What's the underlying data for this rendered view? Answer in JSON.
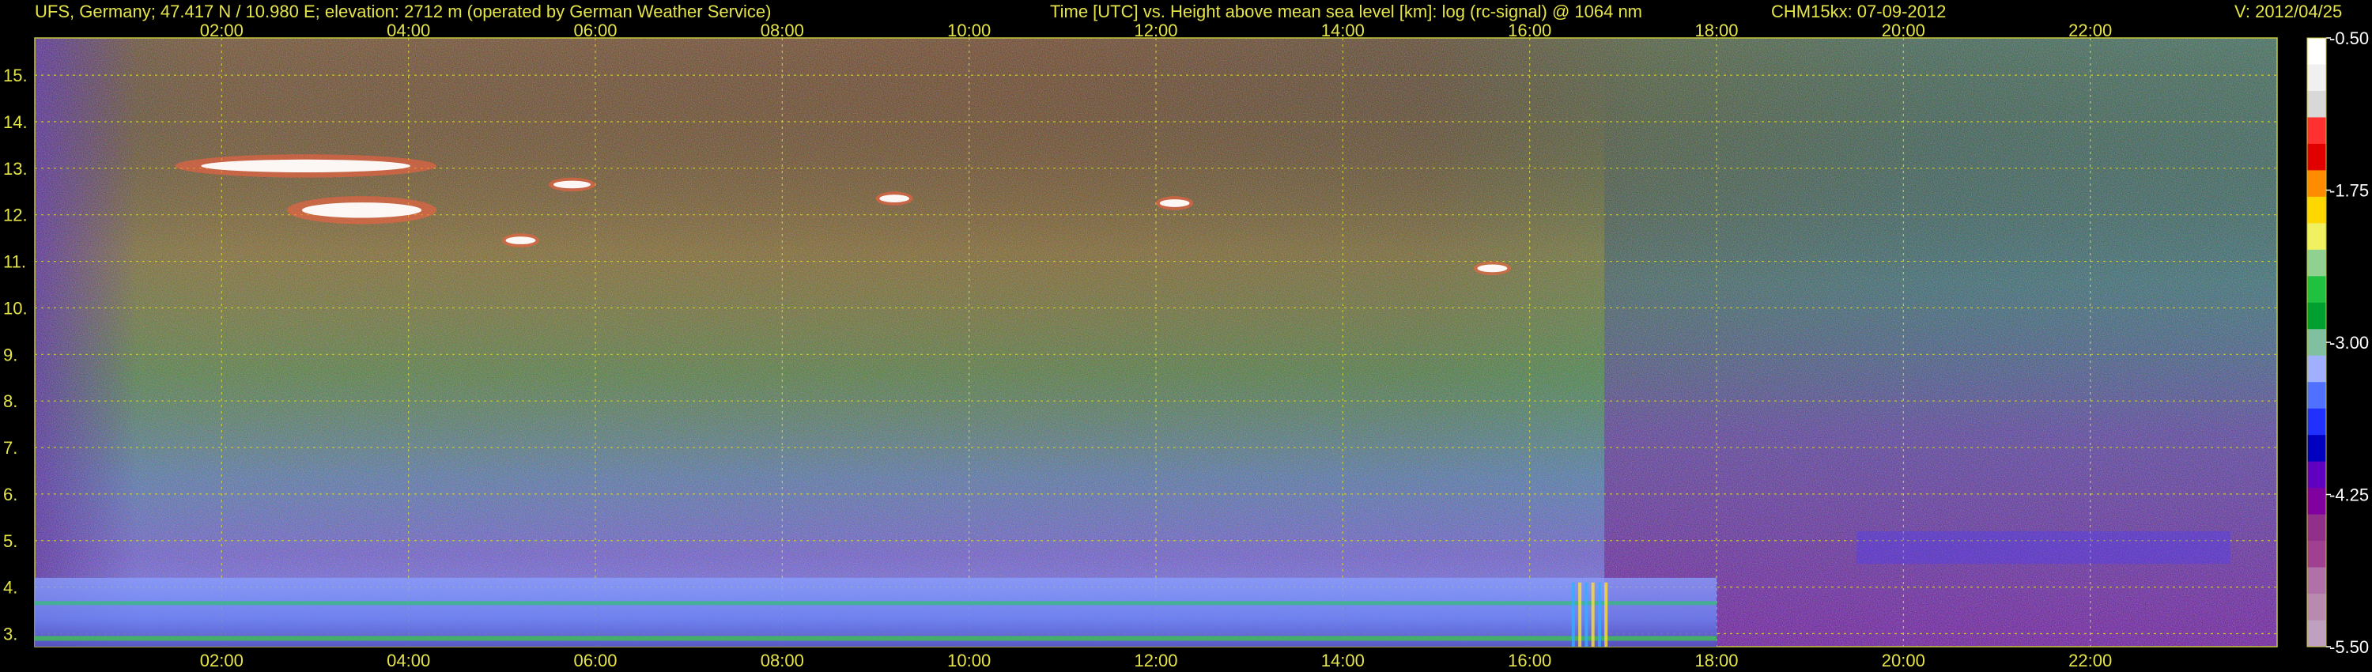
{
  "header": {
    "station": "UFS, Germany; 47.417 N / 10.980 E; elevation: 2712 m  (operated by German Weather Service)",
    "axis_title": "Time [UTC] vs. Height above mean sea level [km]: log (rc-signal) @ 1064 nm",
    "instrument": "CHM15kx: 07-09-2012",
    "version": "V: 2012/04/25"
  },
  "chart_data": {
    "type": "heatmap",
    "title": "Time [UTC] vs. Height above mean sea level [km]: log (rc-signal) @ 1064 nm",
    "x_unit": "hours UTC",
    "xlim": [
      0,
      24
    ],
    "x_ticks": [
      {
        "value": 2,
        "label": "02:00"
      },
      {
        "value": 4,
        "label": "04:00"
      },
      {
        "value": 6,
        "label": "06:00"
      },
      {
        "value": 8,
        "label": "08:00"
      },
      {
        "value": 10,
        "label": "10:00"
      },
      {
        "value": 12,
        "label": "12:00"
      },
      {
        "value": 14,
        "label": "14:00"
      },
      {
        "value": 16,
        "label": "16:00"
      },
      {
        "value": 18,
        "label": "18:00"
      },
      {
        "value": 20,
        "label": "20:00"
      },
      {
        "value": 22,
        "label": "22:00"
      }
    ],
    "y_unit": "km",
    "ylim": [
      2.72,
      15.8
    ],
    "y_ticks": [
      3,
      4,
      5,
      6,
      7,
      8,
      9,
      10,
      11,
      12,
      13,
      14,
      15
    ],
    "y_tick_labels": [
      "3.",
      "4.",
      "5.",
      "6.",
      "7.",
      "8.",
      "9.",
      "10.",
      "11.",
      "12.",
      "13.",
      "14.",
      "15."
    ],
    "grid": true,
    "colorbar": {
      "range": [
        -5.5,
        -0.5
      ],
      "ticks": [
        -0.5,
        -1.75,
        -3.0,
        -4.25,
        -5.5
      ],
      "tick_labels": [
        "-0.50",
        "-1.75",
        "-3.00",
        "-4.25",
        "-5.50"
      ],
      "colors": [
        "#ffffff",
        "#f0f0f0",
        "#d8d8d8",
        "#ff3030",
        "#e00000",
        "#ff8c00",
        "#ffd700",
        "#f0f060",
        "#90d090",
        "#20c040",
        "#00a030",
        "#80c0a0",
        "#a0b0ff",
        "#5070ff",
        "#2030ff",
        "#0000c0",
        "#6000c0",
        "#8000a0",
        "#90308a",
        "#a04090",
        "#b070a8",
        "#b88ab0",
        "#c0a0c0"
      ]
    },
    "features": [
      {
        "name": "cirrus",
        "t_start": 1.5,
        "t_end": 4.3,
        "h_low": 12.8,
        "h_high": 13.3
      },
      {
        "name": "cirrus",
        "t_start": 2.7,
        "t_end": 4.3,
        "h_low": 11.8,
        "h_high": 12.4
      },
      {
        "name": "cirrus",
        "t_start": 5.0,
        "t_end": 5.4,
        "h_low": 11.3,
        "h_high": 11.6
      },
      {
        "name": "cirrus",
        "t_start": 5.5,
        "t_end": 6.0,
        "h_low": 12.5,
        "h_high": 12.8
      },
      {
        "name": "cirrus",
        "t_start": 9.0,
        "t_end": 9.4,
        "h_low": 12.2,
        "h_high": 12.5
      },
      {
        "name": "cirrus",
        "t_start": 12.0,
        "t_end": 12.4,
        "h_low": 12.1,
        "h_high": 12.4
      },
      {
        "name": "cirrus",
        "t_start": 15.4,
        "t_end": 15.8,
        "h_low": 10.7,
        "h_high": 11.0
      },
      {
        "name": "boundary-layer",
        "t_start": 0.0,
        "t_end": 18.0,
        "h_low": 2.72,
        "h_high": 4.2
      },
      {
        "name": "aerosol-layer",
        "t_start": 19.5,
        "t_end": 23.5,
        "h_low": 4.5,
        "h_high": 5.2
      }
    ]
  }
}
